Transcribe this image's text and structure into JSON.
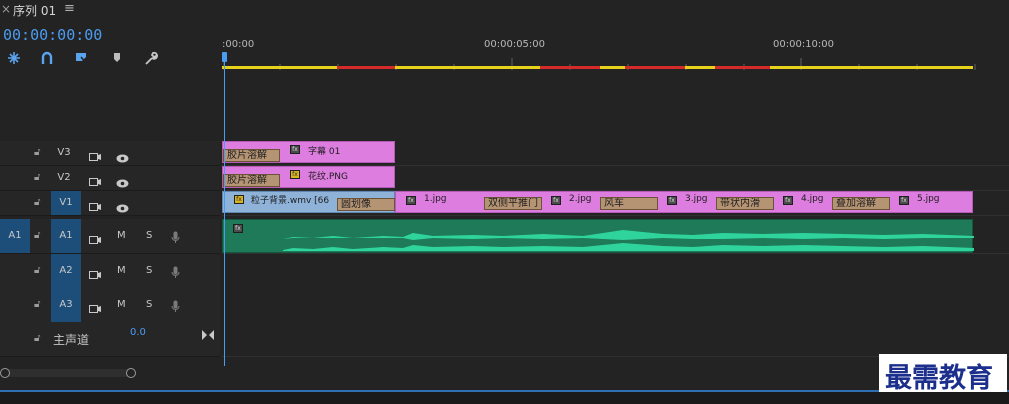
{
  "window": {
    "tab_close": "×",
    "tab_title": "序列 01",
    "tab_menu": "≡"
  },
  "timecode": "00:00:00:00",
  "toolbar": {
    "tools": [
      {
        "name": "snap-icon",
        "glyph": "⁑"
      },
      {
        "name": "magnet-icon",
        "glyph": "∩"
      },
      {
        "name": "linked-selection-icon",
        "glyph": "◆"
      },
      {
        "name": "marker-icon",
        "glyph": "⬟"
      },
      {
        "name": "wrench-icon",
        "glyph": "🔧"
      }
    ]
  },
  "ruler": {
    "labels": [
      ":00:00",
      "00:00:05:00",
      "00:00:10:00"
    ]
  },
  "tracks": {
    "v3": {
      "name": "V3"
    },
    "v2": {
      "name": "V2"
    },
    "v1": {
      "name": "V1"
    },
    "a1": {
      "name": "A1",
      "source": "A1",
      "m": "M",
      "s": "S"
    },
    "a2": {
      "name": "A2",
      "m": "M",
      "s": "S"
    },
    "a3": {
      "name": "A3",
      "m": "M",
      "s": "S"
    },
    "master": {
      "label": "主声道",
      "value": "0.0"
    }
  },
  "clips": {
    "v3_transition": "胶片溶解",
    "v3_clip": "字幕 01",
    "v2_transition": "胶片溶解",
    "v2_clip": "花纹.PNG",
    "v1_first": "粒子背景.wmv [66",
    "v1_trans_1": "圆划像",
    "v1_clip_1": "1.jpg",
    "v1_trans_2": "双侧平推门",
    "v1_clip_2": "2.jpg",
    "v1_trans_3": "风车",
    "v1_clip_3": "3.jpg",
    "v1_trans_4": "带状内滑",
    "v1_clip_4": "4.jpg",
    "v1_trans_5": "叠加溶解",
    "v1_clip_5": "5.jpg"
  },
  "colors": {
    "accent_blue": "#4b9cf0",
    "video_clip": "#dd7ddf",
    "audio_clip": "#1f7a5a",
    "waveform": "#2fd39c",
    "render_yellow": "#e6d21a",
    "render_red": "#d42a2a"
  },
  "watermark": "最需教育"
}
